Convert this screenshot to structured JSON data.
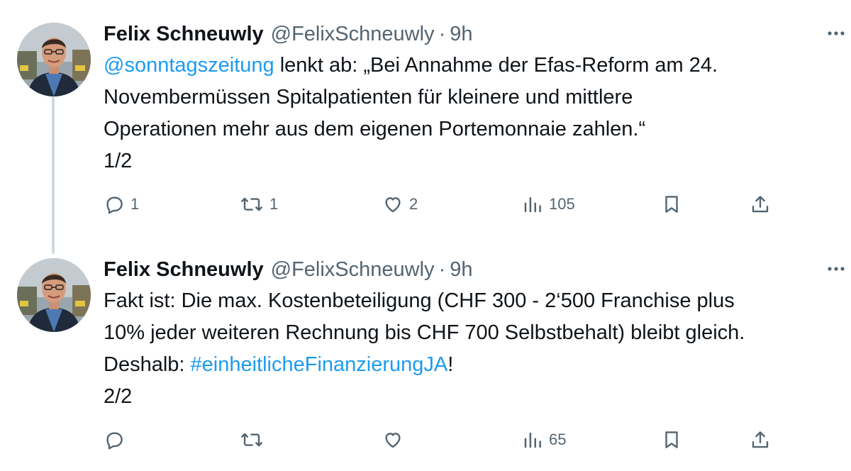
{
  "tweets": [
    {
      "author_name": "Felix Schneuwly",
      "handle": "@FelixSchneuwly",
      "separator": "·",
      "time": "9h",
      "text": {
        "mention": "@sonntagszeitung",
        "line1_rest": " lenkt ab: „Bei Annahme der Efas-Reform am 24.",
        "line2": "Novembermüssen Spitalpatienten für kleinere und mittlere",
        "line3": "Operationen mehr aus dem eigenen Portemonnaie zahlen.“",
        "line4": "1/2"
      },
      "stats": {
        "replies": "1",
        "reposts": "1",
        "likes": "2",
        "views": "105"
      }
    },
    {
      "author_name": "Felix Schneuwly",
      "handle": "@FelixSchneuwly",
      "separator": "·",
      "time": "9h",
      "text": {
        "line1": "Fakt ist: Die max. Kostenbeteiligung (CHF 300 - 2‘500 Franchise plus",
        "line2": "10% jeder weiteren Rechnung bis CHF 700 Selbstbehalt) bleibt gleich.",
        "line3_prefix": "Deshalb: ",
        "hashtag": "#einheitlicheFinanzierungJA",
        "line3_suffix": "!",
        "line4": "2/2"
      },
      "stats": {
        "replies": "",
        "reposts": "",
        "likes": "",
        "views": "65"
      }
    }
  ],
  "icons": {
    "more": "more-horizontal-icon",
    "reply": "reply-icon",
    "repost": "repost-icon",
    "like": "like-icon",
    "views": "views-icon",
    "bookmark": "bookmark-icon",
    "share": "share-icon"
  },
  "colors": {
    "text": "#0f1419",
    "secondary": "#536471",
    "link": "#1d9bf0",
    "thread_line": "#cfd9de"
  }
}
